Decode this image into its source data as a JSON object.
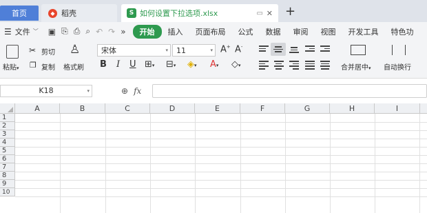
{
  "tabs": {
    "home": "首页",
    "daoke": "稻壳",
    "file": "如何设置下拉选项.xlsx",
    "new_tab": "+"
  },
  "menu": {
    "file": "文件",
    "items": [
      "开始",
      "插入",
      "页面布局",
      "公式",
      "数据",
      "审阅",
      "视图",
      "开发工具",
      "特色功"
    ]
  },
  "ribbon": {
    "paste": "粘贴",
    "cut": "剪切",
    "copy": "复制",
    "format_painter": "格式刷",
    "font_name": "宋体",
    "font_size": "11",
    "merge_center": "合并居中",
    "auto_wrap": "自动换行"
  },
  "formula_bar": {
    "cell_ref": "K18",
    "fx": "fx",
    "formula": ""
  },
  "sheet": {
    "columns": [
      "A",
      "B",
      "C",
      "D",
      "E",
      "F",
      "G",
      "H",
      "I"
    ],
    "rows": [
      "1",
      "2",
      "3",
      "4",
      "5",
      "6",
      "7",
      "8",
      "9",
      "10"
    ]
  },
  "colors": {
    "accent_green": "#2e9a4f",
    "home_tab": "#4f7fd8",
    "daoke_red": "#e8452c"
  }
}
